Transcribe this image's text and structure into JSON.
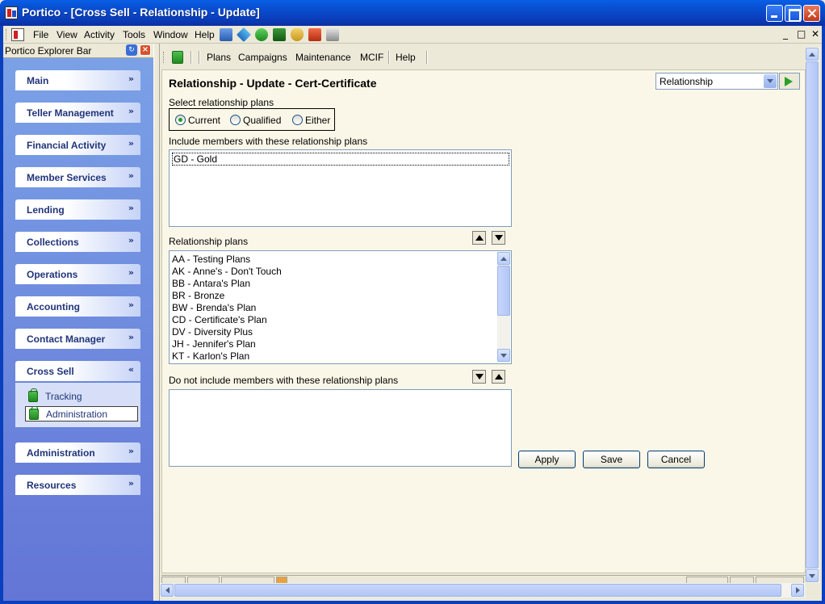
{
  "window": {
    "title": "Portico - [Cross Sell - Relationship - Update]"
  },
  "menu": {
    "items": [
      "File",
      "View",
      "Activity",
      "Tools",
      "Window",
      "Help"
    ],
    "mdi": {
      "minimize": "_",
      "restore": "□",
      "close": "✕"
    }
  },
  "explorer": {
    "title": "Portico Explorer Bar",
    "groups": [
      {
        "label": "Main",
        "icon": "chevron-down-icon"
      },
      {
        "label": "Teller Management",
        "icon": "chevron-down-icon"
      },
      {
        "label": "Financial Activity",
        "icon": "chevron-down-icon"
      },
      {
        "label": "Member Services",
        "icon": "chevron-down-icon"
      },
      {
        "label": "Lending",
        "icon": "chevron-down-icon"
      },
      {
        "label": "Collections",
        "icon": "chevron-down-icon"
      },
      {
        "label": "Operations",
        "icon": "chevron-down-icon"
      },
      {
        "label": "Accounting",
        "icon": "chevron-down-icon"
      },
      {
        "label": "Contact Manager",
        "icon": "chevron-down-icon"
      },
      {
        "label": "Cross Sell",
        "icon": "chevron-up-icon",
        "expanded": true
      },
      {
        "label": "Administration",
        "icon": "chevron-down-icon"
      },
      {
        "label": "Resources",
        "icon": "chevron-down-icon"
      }
    ],
    "chevron_down": "»",
    "chevron_up": "«",
    "cross_sell_items": [
      {
        "label": "Tracking",
        "selected": false
      },
      {
        "label": "Administration",
        "selected": true
      }
    ]
  },
  "content_toolbar": {
    "links": [
      "Plans",
      "Campaigns",
      "Maintenance",
      "MCIF",
      "Help"
    ]
  },
  "form": {
    "title": "Relationship - Update - Cert-Certificate",
    "combo_value": "Relationship",
    "select_label": "Select relationship plans",
    "radios": [
      {
        "label": "Current",
        "checked": true
      },
      {
        "label": "Qualified",
        "checked": false
      },
      {
        "label": "Either",
        "checked": false
      }
    ],
    "include_label": "Include members with these relationship plans",
    "include_items": [
      "GD - Gold"
    ],
    "plans_label": "Relationship plans",
    "plans_items": [
      "AA - Testing Plans",
      "AK - Anne's - Don't Touch",
      "BB - Antara's Plan",
      "BR - Bronze",
      "BW - Brenda's Plan",
      "CD - Certificate's Plan",
      "DV - Diversity Plus",
      "JH - Jennifer's Plan",
      "KT - Karlon's Plan"
    ],
    "exclude_label": "Do not include members with these relationship plans",
    "exclude_items": [],
    "buttons": {
      "apply": "Apply",
      "save": "Save",
      "cancel": "Cancel"
    }
  },
  "colors": {
    "titlebar": "#0a3fbd",
    "explorer_bg": "#7ba2e7",
    "form_bg": "#fbf7e8",
    "nav_label": "#21347a",
    "radio_dot": "#21a121"
  }
}
